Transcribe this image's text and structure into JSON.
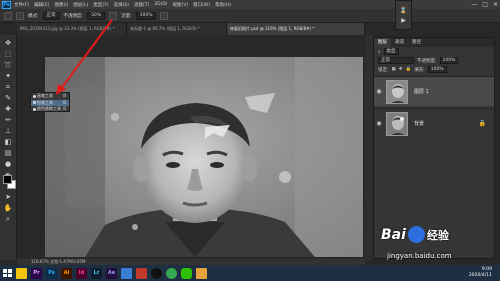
{
  "menubar": {
    "logo": "Ps",
    "items": [
      "文件(F)",
      "编辑(E)",
      "图像(I)",
      "图层(L)",
      "类型(Y)",
      "选择(S)",
      "滤镜(T)",
      "3D(D)",
      "视图(V)",
      "窗口(W)",
      "帮助(H)"
    ],
    "win_controls": [
      "—",
      "□",
      "✕"
    ]
  },
  "options": {
    "mode_label": "模式:",
    "mode_value": "正常",
    "opacity_label": "不透明度:",
    "opacity_value": "50%",
    "flow_label": "流量:",
    "flow_value": "100%"
  },
  "tabs": [
    {
      "label": "IMG_20190413.jpg @ 33.3% (图层 1, RGB/8#) *",
      "active": false
    },
    {
      "label": "未标题-1 @ 66.7% (图层 1, RGB/8) *",
      "active": false
    },
    {
      "label": "修复旧照片.psd @ 116% (图层 1, RGB/8#) *",
      "active": true
    }
  ],
  "context_menu": {
    "items": [
      {
        "label": "画笔工具",
        "key": "B",
        "selected": false
      },
      {
        "label": "铅笔工具",
        "key": "B",
        "selected": true
      },
      {
        "label": "颜色替换工具",
        "key": "B",
        "selected": false
      }
    ]
  },
  "status": {
    "text": "116.67%    文档:1.47M/3.05M"
  },
  "layers_panel": {
    "tabs": [
      "图层",
      "通道",
      "路径"
    ],
    "kind_label": "类型",
    "blend_mode": "正常",
    "opacity_label": "不透明度:",
    "opacity_value": "100%",
    "lock_label": "锁定:",
    "fill_label": "填充:",
    "fill_value": "100%",
    "layers": [
      {
        "name": "图层 1",
        "selected": true
      },
      {
        "name": "背景",
        "selected": false
      }
    ]
  },
  "watermark": {
    "bai": "Bai",
    "du": "经验",
    "url": "jingyan.baidu.com"
  },
  "taskbar": {
    "apps": [
      {
        "label": "Pr",
        "color": "#2a0a4a"
      },
      {
        "label": "Ps",
        "color": "#0c2d4b"
      },
      {
        "label": "Ai",
        "color": "#3a1500"
      },
      {
        "label": "Id",
        "color": "#4a0028"
      },
      {
        "label": "Lr",
        "color": "#0f1e2e"
      },
      {
        "label": "Ae",
        "color": "#1f0f3a"
      }
    ],
    "time": "9:09",
    "date": "2020/4/11"
  }
}
